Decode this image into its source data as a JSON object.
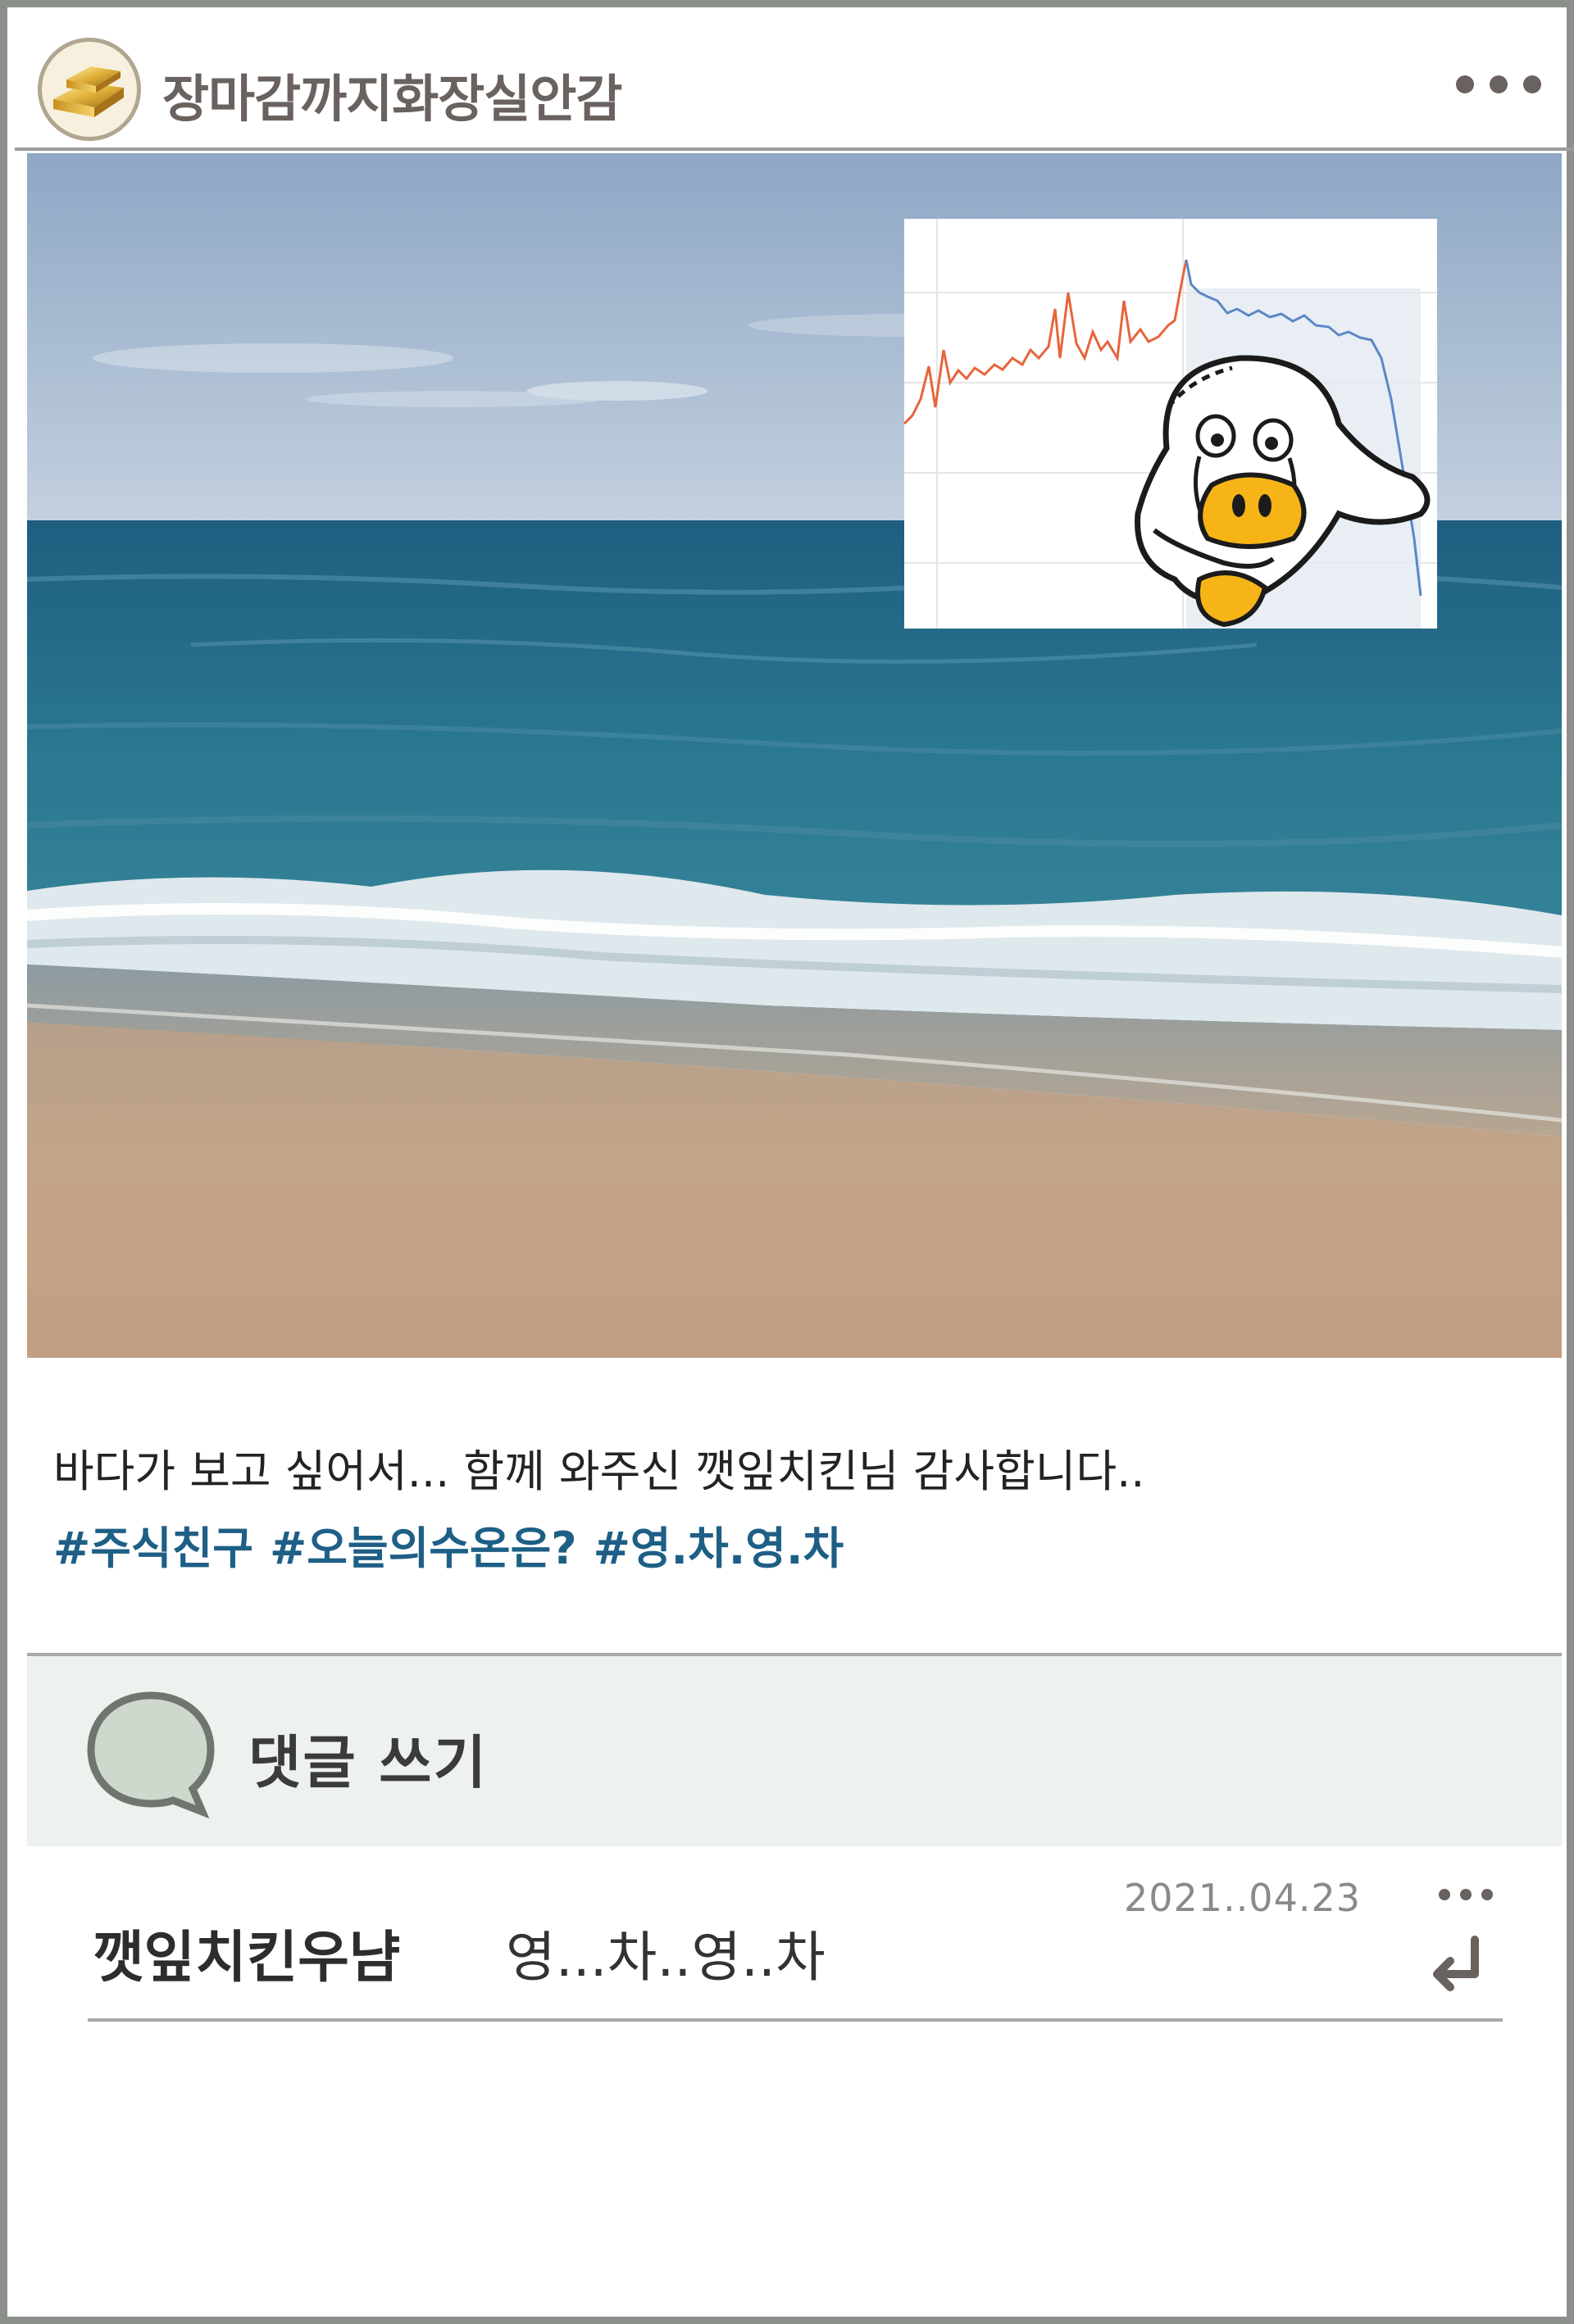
{
  "header": {
    "username": "장마감까지화장실안감",
    "avatar_icon": "gold-bar-icon",
    "more_icon": "more-dots-icon"
  },
  "post": {
    "image_description_icon": "beach-photo",
    "caption": "바다가 보고 싶어서... 함께 와주신 깻잎치킨님 감사합니다..",
    "hashtags": [
      "#주식친구",
      "#오늘의수온은?",
      "#영.차.영.차"
    ]
  },
  "comments": {
    "write_label": "댓글 쓰기",
    "write_icon": "speech-bubble-icon",
    "items": [
      {
        "author": "깻잎치킨우냠",
        "text": "영...차..영..차",
        "date": "2021..04.23",
        "more_icon": "more-dots-icon",
        "reply_icon": "reply-arrow-icon"
      }
    ]
  },
  "colors": {
    "frame": "#8c908b",
    "username": "#6a625f",
    "hashtag": "#1e5f86",
    "comment_bar_bg": "#eef2ee",
    "chart_rise": "#e8643c",
    "chart_fall": "#5b87c5"
  }
}
